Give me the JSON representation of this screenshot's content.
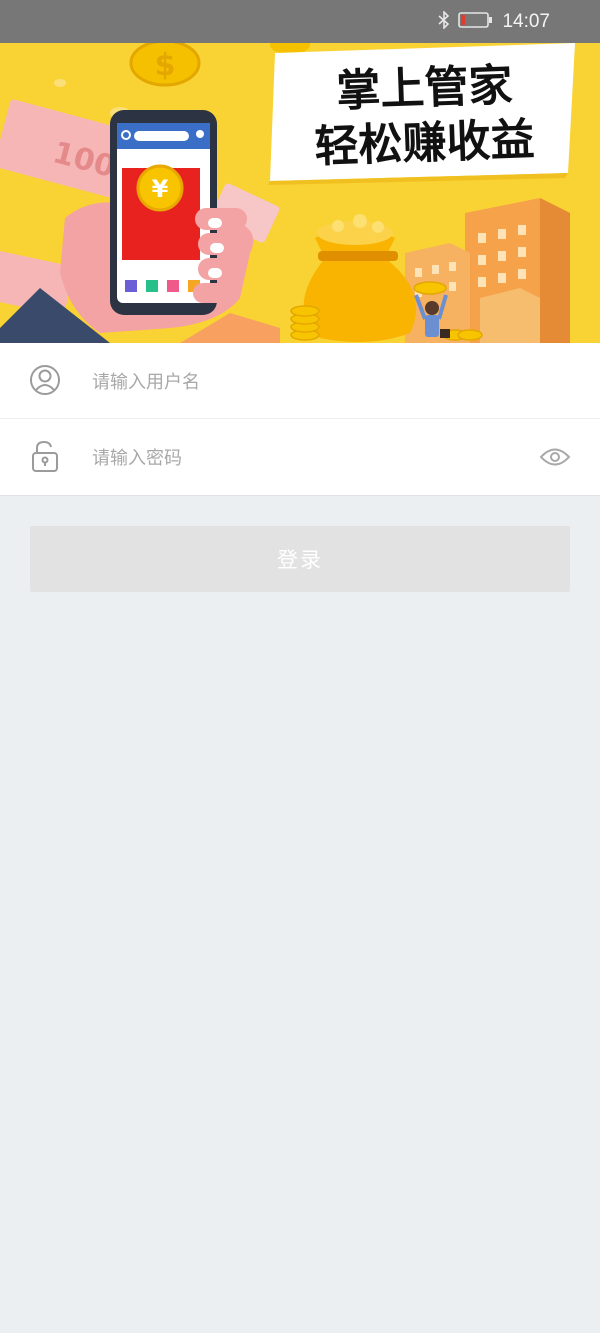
{
  "status_bar": {
    "time": "14:07",
    "icons": [
      "bluetooth-icon",
      "battery-low-icon"
    ]
  },
  "banner": {
    "headline_line1": "掌上管家",
    "headline_line2": "轻松赚收益",
    "currency_symbol": "¥",
    "dollar_symbol": "$",
    "banknote_label": "100",
    "colors": {
      "background": "#f9d233",
      "accent_red": "#e8231f"
    }
  },
  "login_form": {
    "username_placeholder": "请输入用户名",
    "password_placeholder": "请输入密码",
    "submit_label": "登录"
  },
  "colors": {
    "status_bar": "#777777",
    "page_background": "#eceff2",
    "button_disabled": "#e2e2e2",
    "placeholder_text": "#a8a8a8"
  }
}
